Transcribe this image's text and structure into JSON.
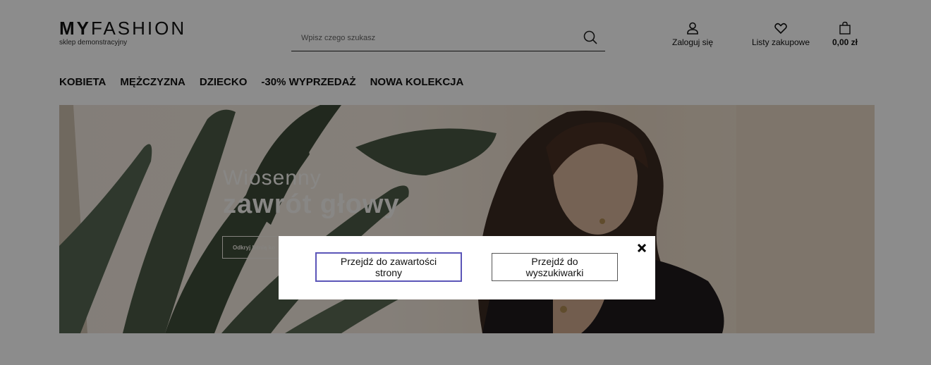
{
  "header": {
    "logo": {
      "bold": "MY",
      "light": "FASHION",
      "tagline": "sklep demonstracyjny"
    },
    "search": {
      "placeholder": "Wpisz czego szukasz"
    },
    "actions": {
      "login": "Zaloguj się",
      "lists": "Listy zakupowe",
      "cart": "0,00 zł"
    }
  },
  "nav": {
    "items": [
      {
        "label": "KOBIETA"
      },
      {
        "label": "MĘŻCZYZNA"
      },
      {
        "label": "DZIECKO"
      },
      {
        "label": "-30% WYPRZEDAŻ"
      },
      {
        "label": "NOWA KOLEKCJA"
      }
    ]
  },
  "hero": {
    "title_line1": "Wiosenny",
    "title_line2": "zawrót głowy",
    "cta": "Odkryj letnią ko"
  },
  "skip_modal": {
    "content_button": "Przejdź do zawartości strony",
    "search_button": "Przejdź do wyszukiwarki"
  },
  "colors": {
    "focus_outline": "#5b55b8",
    "overlay": "rgba(0,0,0,0.45)"
  }
}
